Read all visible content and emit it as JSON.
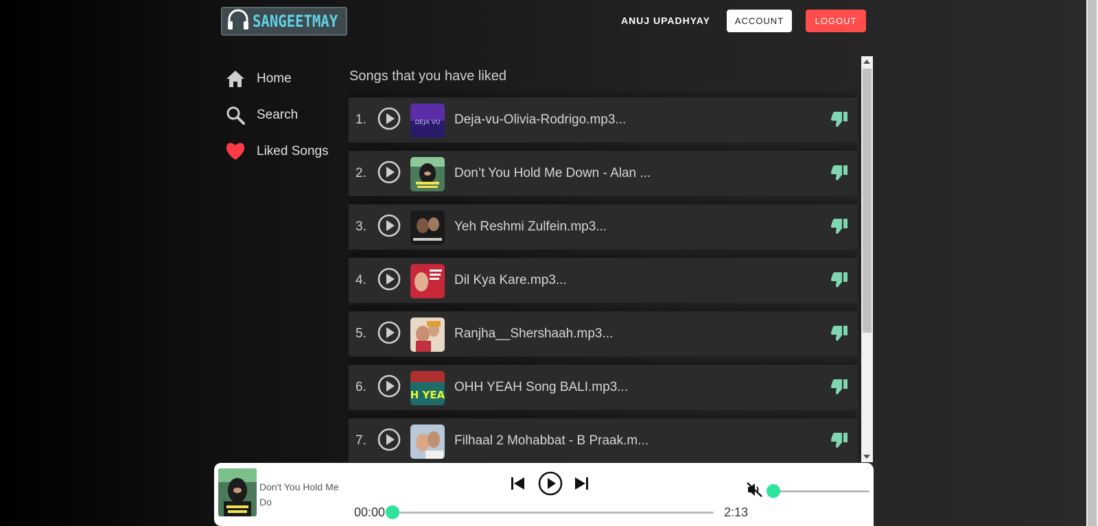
{
  "header": {
    "logo_text": "SANGEETMAY",
    "user_name": "ANUJ UPADHYAY",
    "account_label": "ACCOUNT",
    "logout_label": "LOGOUT"
  },
  "sidebar": {
    "items": [
      {
        "label": "Home",
        "icon": "home-icon"
      },
      {
        "label": "Search",
        "icon": "search-icon"
      },
      {
        "label": "Liked Songs",
        "icon": "heart-icon"
      }
    ]
  },
  "main": {
    "title": "Songs that you have liked",
    "songs": [
      {
        "num": "1.",
        "title": "Deja-vu-Olivia-Rodrigo.mp3..."
      },
      {
        "num": "2.",
        "title": "Don’t You Hold Me Down - Alan ..."
      },
      {
        "num": "3.",
        "title": "Yeh Reshmi Zulfein.mp3..."
      },
      {
        "num": "4.",
        "title": "Dil Kya Kare.mp3..."
      },
      {
        "num": "5.",
        "title": "Ranjha__Shershaah.mp3..."
      },
      {
        "num": "6.",
        "title": "OHH YEAH Song BALI.mp3..."
      },
      {
        "num": "7.",
        "title": "Filhaal 2 Mohabbat - B Praak.m..."
      }
    ]
  },
  "player": {
    "now_playing_title": "Don't You Hold Me Do",
    "current_time": "00:00",
    "duration": "2:13",
    "progress": 0,
    "volume": 0,
    "muted": true
  },
  "colors": {
    "accent_green": "#2ee39c",
    "dislike_green": "#7fd6b0",
    "logout_red": "#ff4d4d",
    "logo_cyan": "#5fd3e6",
    "heart_red": "#ff3b47"
  }
}
